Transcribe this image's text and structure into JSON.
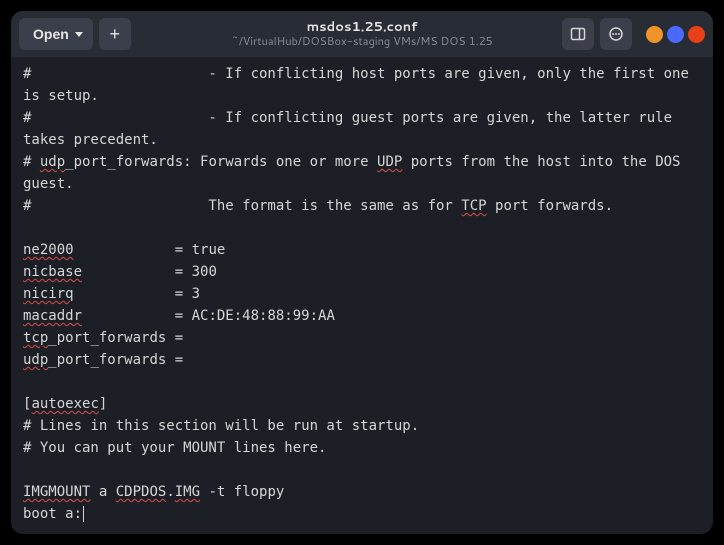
{
  "header": {
    "open_label": "Open",
    "new_tab_label": "+",
    "title": "msdos1.25.conf",
    "subtitle": "~/VirtualHub/DOSBox-staging VMs/MS DOS 1.25"
  },
  "editor": {
    "lines": [
      {
        "segs": [
          {
            "t": "#                     - If conflicting host ports are given, only the first one is setup."
          }
        ]
      },
      {
        "segs": [
          {
            "t": "#                     - If conflicting guest ports are given, the latter rule takes precedent."
          }
        ]
      },
      {
        "segs": [
          {
            "t": "# "
          },
          {
            "t": "udp",
            "u": true
          },
          {
            "t": "_port_forwards: Forwards one or more "
          },
          {
            "t": "UDP",
            "u": true
          },
          {
            "t": " ports from the host into the DOS guest."
          }
        ]
      },
      {
        "segs": [
          {
            "t": "#                     The format is the same as for "
          },
          {
            "t": "TCP",
            "u": true
          },
          {
            "t": " port forwards."
          }
        ]
      },
      {
        "segs": [
          {
            "t": ""
          }
        ]
      },
      {
        "segs": [
          {
            "t": "ne2000",
            "u": true
          },
          {
            "t": "            = true"
          }
        ]
      },
      {
        "segs": [
          {
            "t": "nicbase",
            "u": true
          },
          {
            "t": "           = 300"
          }
        ]
      },
      {
        "segs": [
          {
            "t": "nicirq",
            "u": true
          },
          {
            "t": "            = 3"
          }
        ]
      },
      {
        "segs": [
          {
            "t": "macaddr",
            "u": true
          },
          {
            "t": "           = AC:DE:48:88:99:AA"
          }
        ]
      },
      {
        "segs": [
          {
            "t": "tcp",
            "u": true
          },
          {
            "t": "_port_forwards = "
          }
        ]
      },
      {
        "segs": [
          {
            "t": "udp",
            "u": true
          },
          {
            "t": "_port_forwards = "
          }
        ]
      },
      {
        "segs": [
          {
            "t": ""
          }
        ]
      },
      {
        "segs": [
          {
            "t": "["
          },
          {
            "t": "autoexec",
            "u": true
          },
          {
            "t": "]"
          }
        ]
      },
      {
        "segs": [
          {
            "t": "# Lines in this section will be run at startup."
          }
        ]
      },
      {
        "segs": [
          {
            "t": "# You can put your MOUNT lines here."
          }
        ]
      },
      {
        "segs": [
          {
            "t": ""
          }
        ]
      },
      {
        "segs": [
          {
            "t": "IMGMOUNT",
            "u": true
          },
          {
            "t": " a "
          },
          {
            "t": "CDPDOS",
            "u": true
          },
          {
            "t": "."
          },
          {
            "t": "IMG",
            "u": true
          },
          {
            "t": " -t floppy"
          }
        ]
      },
      {
        "segs": [
          {
            "t": "boot a:"
          }
        ],
        "cursor": true
      }
    ]
  },
  "colors": {
    "bg": "#1c1f26",
    "headerbar": "#282c34",
    "accent_orange": "#f0932b",
    "accent_blue": "#4a69ff",
    "accent_red": "#e84118",
    "spellcheck_underline": "#d94a4a"
  }
}
